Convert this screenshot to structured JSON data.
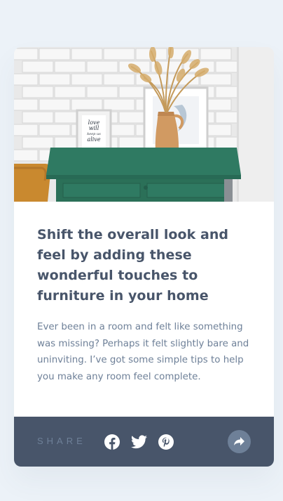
{
  "card": {
    "title": "Shift the overall look and feel by adding these wonderful touches to furniture in your home",
    "description": "Ever been in a room and felt like something was missing? Perhaps it felt slightly bare and uninviting. I’ve got some simple tips to help you make any room feel complete.",
    "image": {
      "frame_text": [
        "love",
        "will",
        "keep us",
        "alive"
      ]
    }
  },
  "share": {
    "label": "SHARE",
    "icons": [
      "facebook-icon",
      "twitter-icon",
      "pinterest-icon",
      "share-arrow-icon"
    ]
  },
  "colors": {
    "page_background": "#ecf2f8",
    "card_background": "#ffffff",
    "title": "#48556a",
    "text": "#6e8098",
    "share_bar": "#48556a",
    "share_button": "#6e8098",
    "drawer_green": "#2f7a62"
  }
}
